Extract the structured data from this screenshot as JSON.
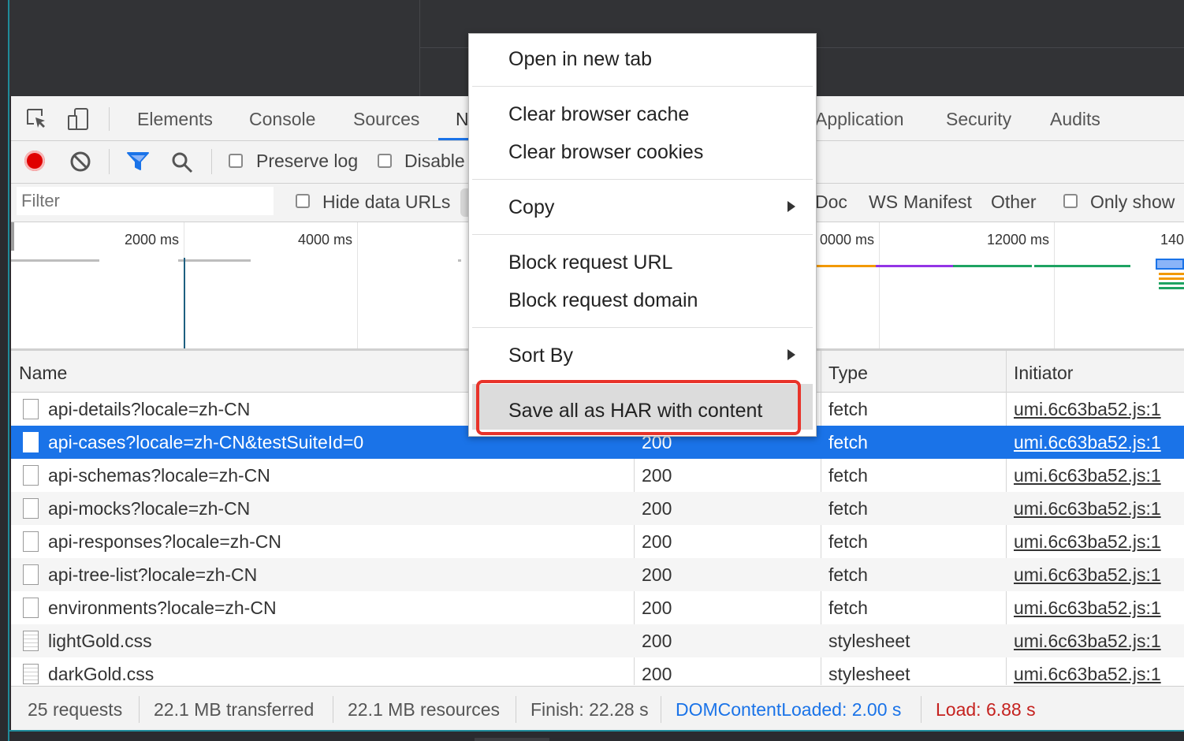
{
  "tabs": [
    {
      "label": "Elements"
    },
    {
      "label": "Console"
    },
    {
      "label": "Sources"
    },
    {
      "label": "N"
    },
    {
      "label": "Application"
    },
    {
      "label": "Security"
    },
    {
      "label": "Audits"
    }
  ],
  "toolbar": {
    "preserve_log": "Preserve log",
    "disable_cache": "Disable"
  },
  "filterbar": {
    "placeholder": "Filter",
    "hide_data_urls": "Hide data URLs",
    "types": [
      "Doc",
      "WS",
      "Manifest",
      "Other"
    ],
    "only_show": "Only show"
  },
  "overview": {
    "ticks": [
      "2000 ms",
      "4000 ms",
      "0000 ms",
      "12000 ms",
      "140"
    ]
  },
  "table": {
    "headers": {
      "name": "Name",
      "type": "Type",
      "initiator": "Initiator"
    },
    "rows": [
      {
        "name": "api-details?locale=zh-CN",
        "status": "",
        "type": "fetch",
        "initiator": "umi.6c63ba52.js:1"
      },
      {
        "name": "api-cases?locale=zh-CN&testSuiteId=0",
        "status": "200",
        "type": "fetch",
        "initiator": "umi.6c63ba52.js:1"
      },
      {
        "name": "api-schemas?locale=zh-CN",
        "status": "200",
        "type": "fetch",
        "initiator": "umi.6c63ba52.js:1"
      },
      {
        "name": "api-mocks?locale=zh-CN",
        "status": "200",
        "type": "fetch",
        "initiator": "umi.6c63ba52.js:1"
      },
      {
        "name": "api-responses?locale=zh-CN",
        "status": "200",
        "type": "fetch",
        "initiator": "umi.6c63ba52.js:1"
      },
      {
        "name": "api-tree-list?locale=zh-CN",
        "status": "200",
        "type": "fetch",
        "initiator": "umi.6c63ba52.js:1"
      },
      {
        "name": "environments?locale=zh-CN",
        "status": "200",
        "type": "fetch",
        "initiator": "umi.6c63ba52.js:1"
      },
      {
        "name": "lightGold.css",
        "status": "200",
        "type": "stylesheet",
        "initiator": "umi.6c63ba52.js:1"
      },
      {
        "name": "darkGold.css",
        "status": "200",
        "type": "stylesheet",
        "initiator": "umi.6c63ba52.js:1"
      }
    ]
  },
  "statusbar": {
    "requests": "25 requests",
    "transferred": "22.1 MB transferred",
    "resources": "22.1 MB resources",
    "finish": "Finish: 22.28 s",
    "domcontentloaded": "DOMContentLoaded: 2.00 s",
    "load": "Load: 6.88 s"
  },
  "context_menu": {
    "open_new_tab": "Open in new tab",
    "clear_cache": "Clear browser cache",
    "clear_cookies": "Clear browser cookies",
    "copy": "Copy",
    "block_url": "Block request URL",
    "block_domain": "Block request domain",
    "sort_by": "Sort By",
    "save_har": "Save all as HAR with content"
  },
  "colors": {
    "accent": "#1a73e8",
    "record": "#e00000",
    "highlight_box": "#e8332a",
    "domcontentloaded": "#1a73e8",
    "load": "#c5221f"
  }
}
